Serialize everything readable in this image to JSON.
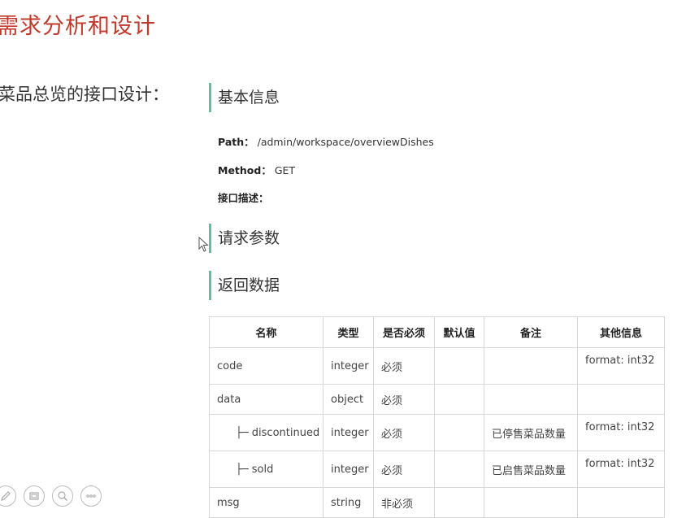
{
  "page": {
    "title": "需求分析和设计",
    "subtitle": "菜品总览的接口设计："
  },
  "sections": {
    "basic_info": "基本信息",
    "request_params": "请求参数",
    "response_data": "返回数据"
  },
  "basic": {
    "path_label": "Path：",
    "path_value": "/admin/workspace/overviewDishes",
    "method_label": "Method：",
    "method_value": "GET",
    "desc_label": "接口描述："
  },
  "table": {
    "headers": [
      "名称",
      "类型",
      "是否必须",
      "默认值",
      "备注",
      "其他信息"
    ],
    "rows": [
      {
        "name": "code",
        "type": "integer",
        "required": "必须",
        "default": "",
        "remark": "",
        "other": "format: int32"
      },
      {
        "name": "data",
        "type": "object",
        "required": "必须",
        "default": "",
        "remark": "",
        "other": ""
      },
      {
        "name": "├─ discontinued",
        "type": "integer",
        "required": "必须",
        "default": "",
        "remark": "已停售菜品数量",
        "other": "format: int32"
      },
      {
        "name": "├─ sold",
        "type": "integer",
        "required": "必须",
        "default": "",
        "remark": "已启售菜品数量",
        "other": "format: int32"
      },
      {
        "name": "msg",
        "type": "string",
        "required": "非必须",
        "default": "",
        "remark": "",
        "other": ""
      }
    ]
  },
  "toolbar": {
    "icons": [
      "pen-icon",
      "slides-icon",
      "zoom-icon",
      "more-icon"
    ]
  },
  "colors": {
    "title": "#c0392b",
    "section_bar": "#5ec0a0"
  }
}
